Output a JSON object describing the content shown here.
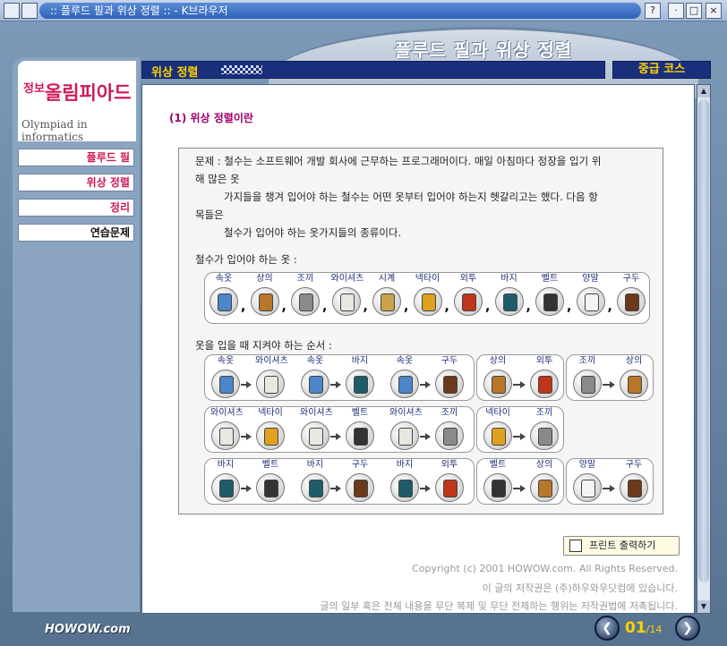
{
  "window": {
    "title": ":: 플루드 필과 위상 정렬 :: - K브라우저",
    "buttons": [
      "?",
      "·",
      "□",
      "×"
    ]
  },
  "header": {
    "page_title": "플루드 필과 위상 정렬",
    "section_label": "위상 정렬",
    "course_label": "중급 코스"
  },
  "logo": {
    "small": "정보",
    "main": "올림피아드",
    "en": "Olympiad in informatics"
  },
  "sidebar": {
    "items": [
      {
        "label": "플루드 필"
      },
      {
        "label": "위상 정렬"
      },
      {
        "label": "정리"
      },
      {
        "label": "연습문제"
      }
    ]
  },
  "main": {
    "heading": "(1) 위상 정렬이란",
    "problem_lines": [
      "문제 : 철수는 소프트웨어 개발 회사에 근무하는 프로그래머이다. 매일 아침마다 정장을 입기 위",
      "해 많은 옷",
      "가지들을 챙겨 입어야 하는 철수는 어떤 옷부터 입어야 하는지 헷갈리고는 했다. 다음 항",
      "목들은",
      "철수가 입어야 하는 옷가지들의 종류이다."
    ],
    "clothes_label": "철수가 입어야 하는 옷 :",
    "clothes": [
      "속옷",
      "상의",
      "조끼",
      "와이셔츠",
      "시계",
      "넥타이",
      "외투",
      "바지",
      "벨트",
      "양말",
      "구두"
    ],
    "order_label": "옷을 입을 때 지켜야 하는 순서 :",
    "orders": {
      "row1": [
        [
          "속옷",
          "와이셔츠",
          "속옷",
          "바지",
          "속옷",
          "구두"
        ],
        [
          "상의",
          "외투"
        ],
        [
          "조끼",
          "상의"
        ]
      ],
      "row2": [
        [
          "와이셔츠",
          "넥타이",
          "와이셔츠",
          "벨트",
          "와이셔츠",
          "조끼"
        ],
        [
          "넥타이",
          "조끼"
        ]
      ],
      "row3": [
        [
          "바지",
          "벨트",
          "바지",
          "구두",
          "바지",
          "외투"
        ],
        [
          "벨트",
          "상의"
        ],
        [
          "양말",
          "구두"
        ]
      ]
    },
    "print_label": "프린트 출력하기",
    "copyright": [
      "Copyright (c) 2001 HOWOW.com. All Rights Reserved.",
      "이 글의 저작권은 (주)하우와우닷컴에 있습니다.",
      "글의 일부 혹은 전체 내용을 무단 복제 및 무단 전제하는 행위는 저작권법에 저촉됩니다."
    ]
  },
  "footer": {
    "brand": "HOWOW.com",
    "page_current": "01",
    "page_total": "/14"
  },
  "colors": {
    "accent": "#cf1a5a",
    "nav_bar": "#1a2f7c",
    "highlight": "#ffd200"
  }
}
